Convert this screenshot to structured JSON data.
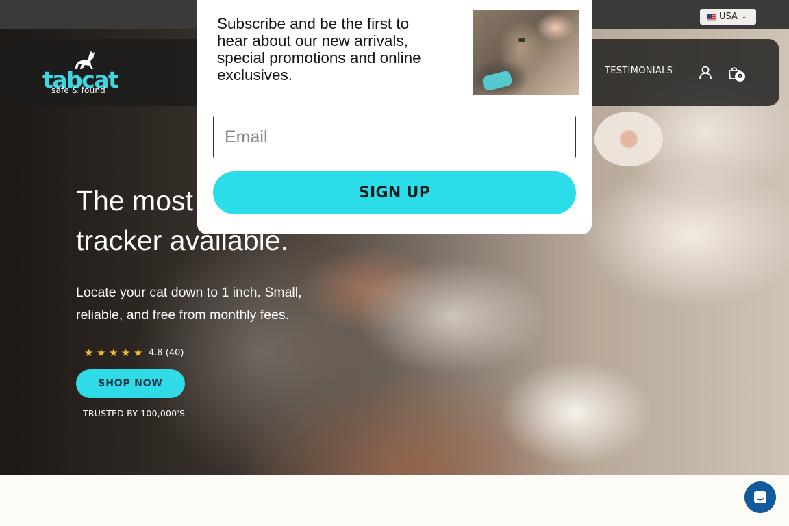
{
  "topbar": {
    "country": "USA",
    "flag_icon": "us-flag-icon",
    "chevron_icon": "chevron-down-icon"
  },
  "nav": {
    "logo": {
      "word": "tabcat",
      "tagline": "safe & found"
    },
    "link_testimonials": "TESTIMONIALS",
    "account_icon": "user-icon",
    "cart_icon": "shopping-bag-icon",
    "cart_count": "0"
  },
  "hero": {
    "headline_line1": "The most",
    "headline_line2": "tracker available.",
    "sub_line1": "Locate your cat down to 1 inch. Small,",
    "sub_line2": "reliable, and free from monthly fees.",
    "rating": {
      "stars": 5,
      "text": "4.8 (40)"
    },
    "shop_button": "SHOP NOW",
    "trusted": "TRUSTED BY 100,000'S"
  },
  "popup": {
    "text_line1": "Subscribe and be the first to",
    "text_line2": "hear about our new arrivals,",
    "text_line3": "special promotions and online",
    "text_line4": "exclusives.",
    "email_placeholder": "Email",
    "signup_button": "SIGN UP"
  },
  "chat": {
    "icon": "chat-icon"
  },
  "colors": {
    "accent": "#2BDDE8",
    "nav_bg": "#1C1C1C",
    "topbar": "#3A3A3A",
    "chat": "#125A9E"
  }
}
